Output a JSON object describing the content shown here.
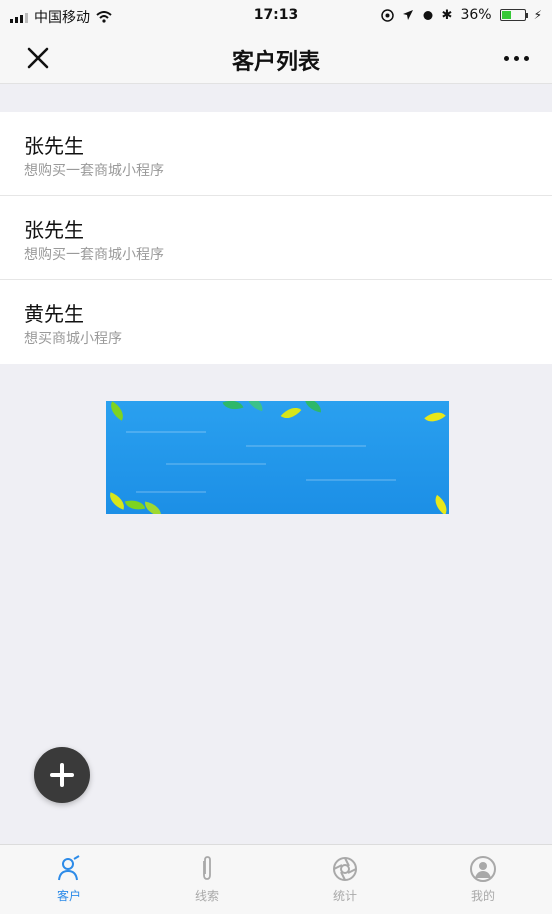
{
  "status_bar": {
    "carrier": "中国移动",
    "time": "17:13",
    "battery": "36%",
    "battery_level": 0.36
  },
  "nav": {
    "title": "客户列表"
  },
  "customers": [
    {
      "name": "张先生",
      "desc": "想购买一套商城小程序"
    },
    {
      "name": "张先生",
      "desc": "想购买一套商城小程序"
    },
    {
      "name": "黄先生",
      "desc": "想买商城小程序"
    }
  ],
  "tabs": [
    {
      "label": "客户",
      "icon": "user-icon",
      "active": true
    },
    {
      "label": "线索",
      "icon": "paperclip-icon",
      "active": false
    },
    {
      "label": "统计",
      "icon": "aperture-icon",
      "active": false
    },
    {
      "label": "我的",
      "icon": "profile-icon",
      "active": false
    }
  ],
  "colors": {
    "accent": "#2d8be8",
    "background": "#efeff4",
    "fab": "#3a3a3a",
    "banner": "#1c8fe6"
  }
}
